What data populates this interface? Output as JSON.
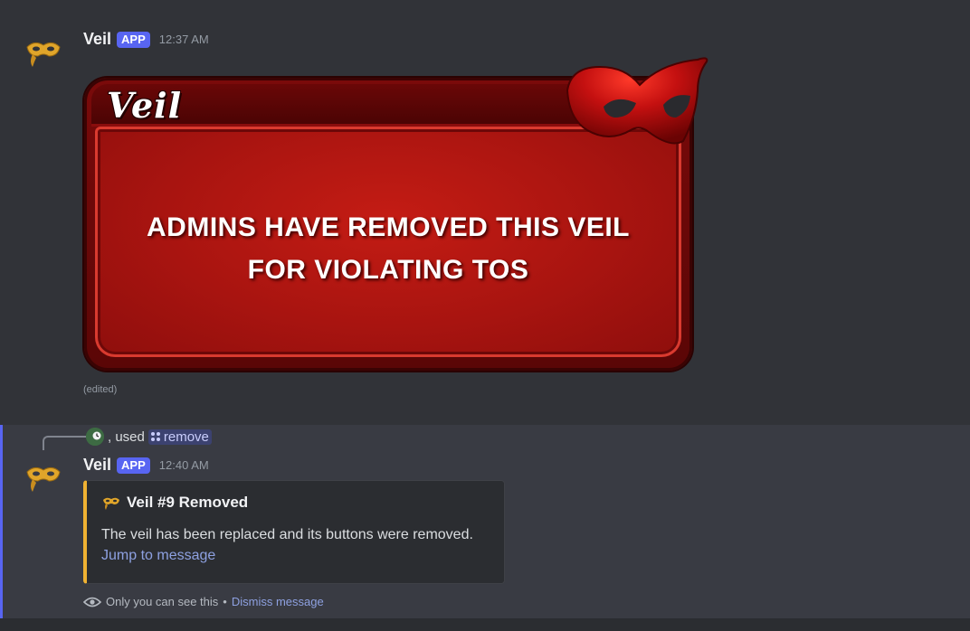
{
  "message1": {
    "username": "Veil",
    "badge": "APP",
    "timestamp": "12:37 AM",
    "card": {
      "title": "Veil",
      "line1": "ADMINS HAVE REMOVED THIS VEIL",
      "line2": "FOR VIOLATING TOS",
      "icon": "red-masquerade-mask"
    },
    "edited": "(edited)"
  },
  "message2": {
    "reply": {
      "text": ", used",
      "command": "remove",
      "avatar_icon": "green-clock-avatar"
    },
    "username": "Veil",
    "badge": "APP",
    "timestamp": "12:40 AM",
    "embed": {
      "title": "Veil #9 Removed",
      "description": "The veil has been replaced and its buttons were removed.",
      "link": "Jump to message",
      "accent_color": "#f0b232"
    },
    "ephemeral_note": "Only you can see this",
    "separator": "•",
    "dismiss_label": "Dismiss message"
  },
  "colors": {
    "background": "#313338",
    "highlight": "#393b43",
    "badge": "#5865f2",
    "link": "#8ea1e1",
    "mask_gold": "#e0a52a"
  }
}
